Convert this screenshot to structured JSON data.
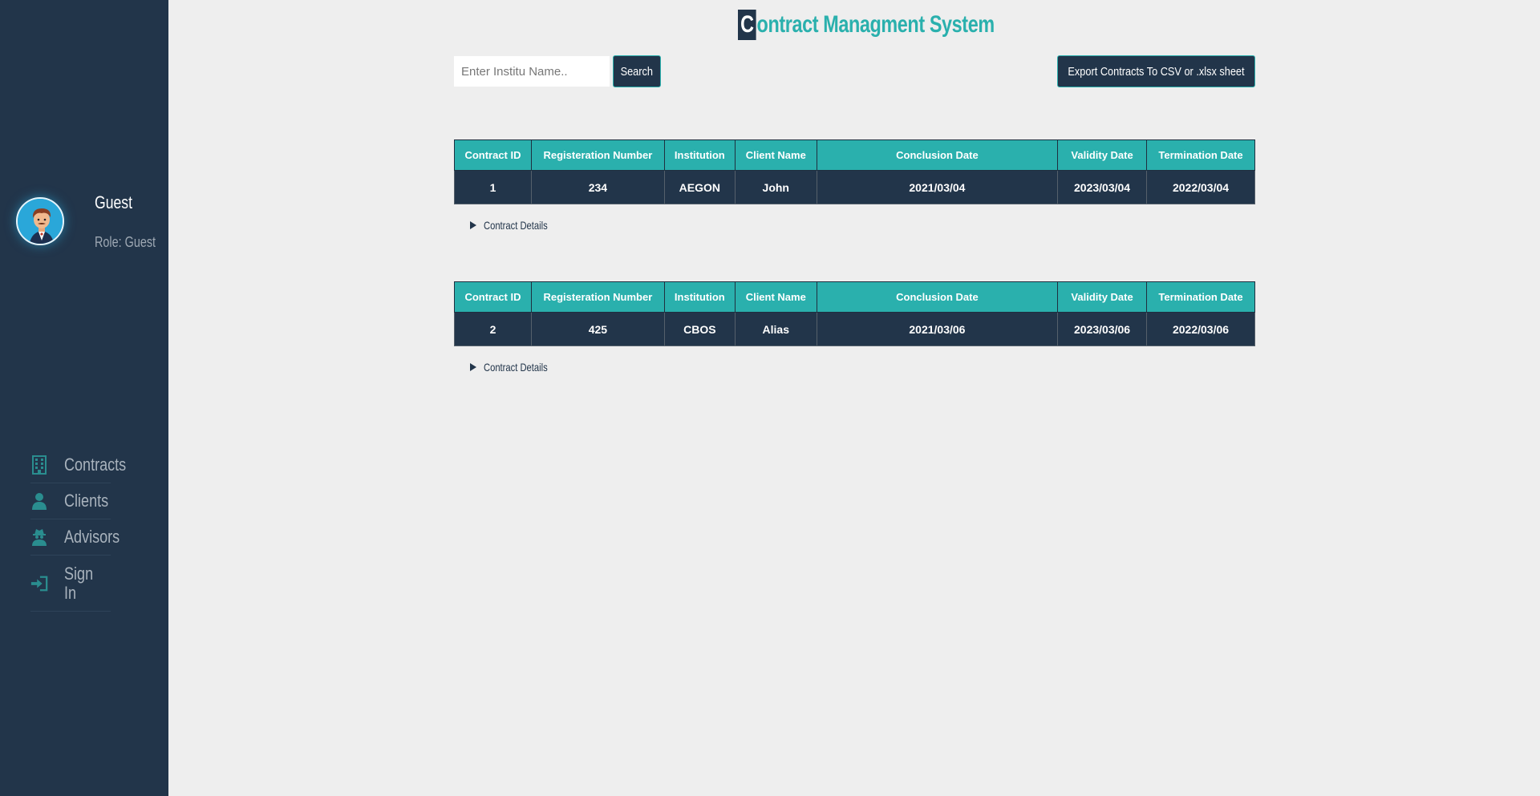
{
  "sidebar": {
    "user": {
      "name": "Guest",
      "role": "Role: Guest"
    },
    "nav": [
      {
        "label": "Contracts",
        "icon": "building-icon"
      },
      {
        "label": "Clients",
        "icon": "user-icon"
      },
      {
        "label": "Advisors",
        "icon": "user-secret-icon"
      },
      {
        "label": "Sign In",
        "icon": "sign-in-icon"
      }
    ]
  },
  "header": {
    "title_first": "C",
    "title_rest": "ontract Managment System"
  },
  "search": {
    "placeholder": "Enter Institu Name..",
    "button": "Search"
  },
  "export": {
    "button": "Export Contracts To CSV or .xlsx sheet"
  },
  "table_headers": [
    "Contract ID",
    "Registeration Number",
    "Institution",
    "Client Name",
    "Conclusion Date",
    "Validity Date",
    "Termination Date"
  ],
  "contracts": [
    {
      "row": [
        "1",
        "234",
        "AEGON",
        "John",
        "2021/03/04",
        "2023/03/04",
        "2022/03/04"
      ],
      "details": "Contract Details"
    },
    {
      "row": [
        "2",
        "425",
        "CBOS",
        "Alias",
        "2021/03/06",
        "2023/03/06",
        "2022/03/06"
      ],
      "details": "Contract Details"
    }
  ],
  "colors": {
    "sidebar": "#22354a",
    "accent": "#2ab0ad",
    "background": "#eeeeee"
  }
}
